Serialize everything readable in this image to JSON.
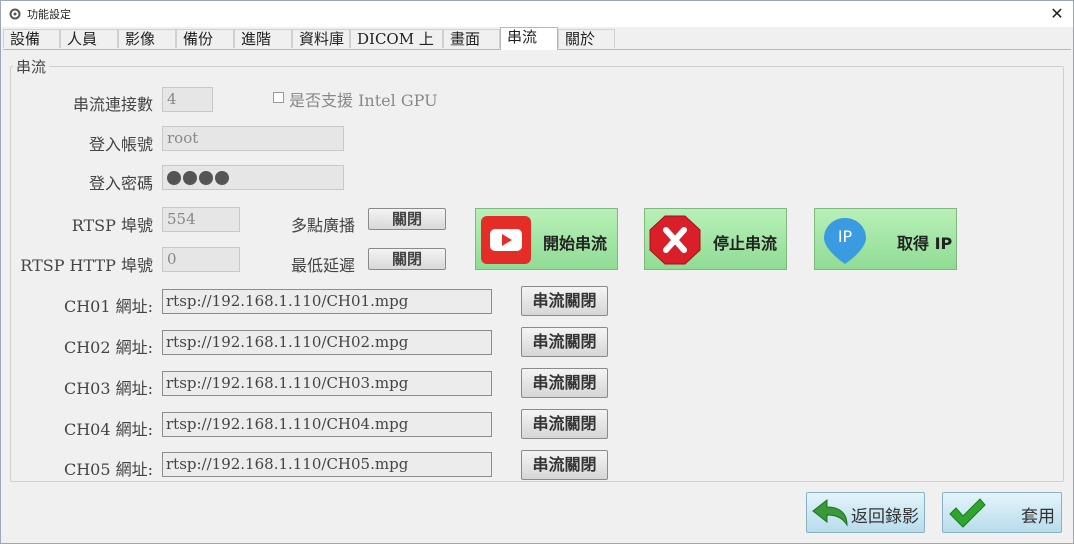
{
  "window": {
    "title": "功能設定",
    "close_label": "✕"
  },
  "tabs": [
    {
      "label": "設備"
    },
    {
      "label": "人員"
    },
    {
      "label": "影像"
    },
    {
      "label": "備份"
    },
    {
      "label": "進階"
    },
    {
      "label": "資料庫"
    },
    {
      "label": "DICOM 上傳"
    },
    {
      "label": "畫面"
    },
    {
      "label": "串流"
    },
    {
      "label": "關於"
    }
  ],
  "active_tab": "串流",
  "group": {
    "label": "串流"
  },
  "form": {
    "connections_label": "串流連接數",
    "connections_value": "4",
    "intel_gpu_label": "是否支援 Intel GPU",
    "intel_gpu_checked": false,
    "account_label": "登入帳號",
    "account_value": "root",
    "password_label": "登入密碼",
    "password_mask_count": 4,
    "rtsp_port_label": "RTSP 埠號",
    "rtsp_port_value": "554",
    "rtsp_http_port_label": "RTSP HTTP 埠號",
    "rtsp_http_port_value": "0",
    "multicast_label": "多點廣播",
    "multicast_button": "關閉",
    "low_latency_label": "最低延遲",
    "low_latency_button": "關閉"
  },
  "actions": {
    "start": "開始串流",
    "stop": "停止串流",
    "get_ip": "取得 IP",
    "ip_icon_text": "IP"
  },
  "channels": [
    {
      "label": "CH01 網址:",
      "url": "rtsp://192.168.1.110/CH01.mpg",
      "button": "串流關閉"
    },
    {
      "label": "CH02 網址:",
      "url": "rtsp://192.168.1.110/CH02.mpg",
      "button": "串流關閉"
    },
    {
      "label": "CH03 網址:",
      "url": "rtsp://192.168.1.110/CH03.mpg",
      "button": "串流關閉"
    },
    {
      "label": "CH04 網址:",
      "url": "rtsp://192.168.1.110/CH04.mpg",
      "button": "串流關閉"
    },
    {
      "label": "CH05 網址:",
      "url": "rtsp://192.168.1.110/CH05.mpg",
      "button": "串流關閉"
    }
  ],
  "footer": {
    "back": "返回錄影",
    "apply": "套用"
  },
  "colors": {
    "action_green": "#a4e6a6",
    "youtube_red": "#e52d27",
    "stop_red": "#d9202a",
    "ip_blue": "#3a9be0",
    "check_green": "#2fa52f"
  }
}
